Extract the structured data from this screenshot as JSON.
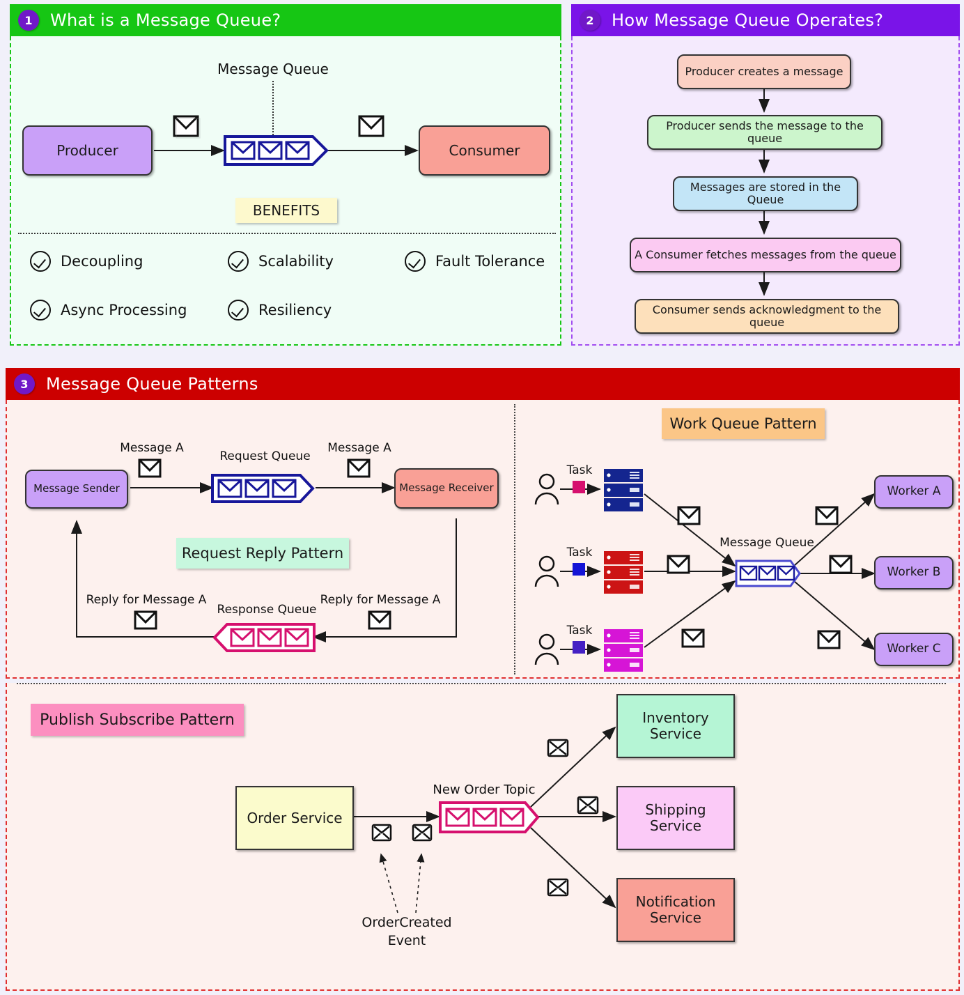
{
  "page": {
    "background": "#f1f0fa"
  },
  "panels": [
    {
      "number": "1",
      "title": "What is a Message Queue?",
      "header_color": "#16c614",
      "border_color": "#16c614",
      "body_color": "#f0fdf6"
    },
    {
      "number": "2",
      "title": "How Message Queue Operates?",
      "header_color": "#7a14e8",
      "border_color": "#a24ef0",
      "body_color": "#f4eafd"
    },
    {
      "number": "3",
      "title": "Message Queue Patterns",
      "header_color": "#cc0000",
      "border_color": "#e03030",
      "body_color": "#fdf1ee"
    }
  ],
  "panel1": {
    "queue_label": "Message Queue",
    "producer": "Producer",
    "consumer": "Consumer",
    "benefits_title": "BENEFITS",
    "benefits": [
      "Decoupling",
      "Scalability",
      "Fault Tolerance",
      "Async Processing",
      "Resiliency"
    ],
    "colors": {
      "producer": "#c9a0f8",
      "consumer": "#f9a096",
      "queue_stroke": "#17179a",
      "benefits_bg": "#fdf9cd"
    }
  },
  "panel2": {
    "steps": [
      {
        "text": "Producer creates a message",
        "color": "#fbd0c4"
      },
      {
        "text": "Producer sends the message to the queue",
        "color": "#ccf5cc"
      },
      {
        "text": "Messages are stored in the Queue",
        "color": "#c3e5f7"
      },
      {
        "text": "A Consumer fetches messages from the queue",
        "color": "#fbcaf2"
      },
      {
        "text": "Consumer sends acknowledgment to the queue",
        "color": "#fde0bb"
      }
    ]
  },
  "panel3": {
    "request_reply": {
      "tag": "Request Reply Pattern",
      "tag_color": "#c7f7de",
      "sender": "Message Sender",
      "receiver": "Message Receiver",
      "request_queue_label": "Request Queue",
      "response_queue_label": "Response Queue",
      "msg_top_left": "Message A",
      "msg_top_right": "Message A",
      "reply_left": "Reply for Message A",
      "reply_right": "Reply for Message A",
      "colors": {
        "sender": "#c9a0f8",
        "receiver": "#f9a096",
        "request_queue_stroke": "#17179a",
        "response_queue_stroke": "#d6106e"
      }
    },
    "work_queue": {
      "tag": "Work Queue Pattern",
      "tag_color": "#fbc687",
      "queue_label": "Message Queue",
      "tasks": [
        {
          "label": "Task",
          "marker_color": "#d6106e",
          "server_color": "#14258f"
        },
        {
          "label": "Task",
          "marker_color": "#1414d6",
          "server_color": "#cc1414"
        },
        {
          "label": "Task",
          "marker_color": "#4420c4",
          "server_color": "#d615d6"
        }
      ],
      "workers": [
        {
          "label": "Worker A",
          "color": "#c9a0f8"
        },
        {
          "label": "Worker B",
          "color": "#c9a0f8"
        },
        {
          "label": "Worker C",
          "color": "#c9a0f8"
        }
      ],
      "queue_stroke": "#17179a"
    },
    "pub_sub": {
      "tag": "Publish Subscribe Pattern",
      "tag_color": "#fc8fc0",
      "publisher": "Order Service",
      "publisher_color": "#fbfbcc",
      "topic_label": "New Order Topic",
      "topic_stroke": "#d6106e",
      "event_label_line1": "OrderCreated",
      "event_label_line2": "Event",
      "subscribers": [
        {
          "line1": "Inventory",
          "line2": "Service",
          "color": "#b5f5d5"
        },
        {
          "line1": "Shipping Service",
          "line2": "",
          "color": "#fbcaf7"
        },
        {
          "line1": "Notification",
          "line2": "Service",
          "color": "#f9a096"
        }
      ]
    }
  }
}
